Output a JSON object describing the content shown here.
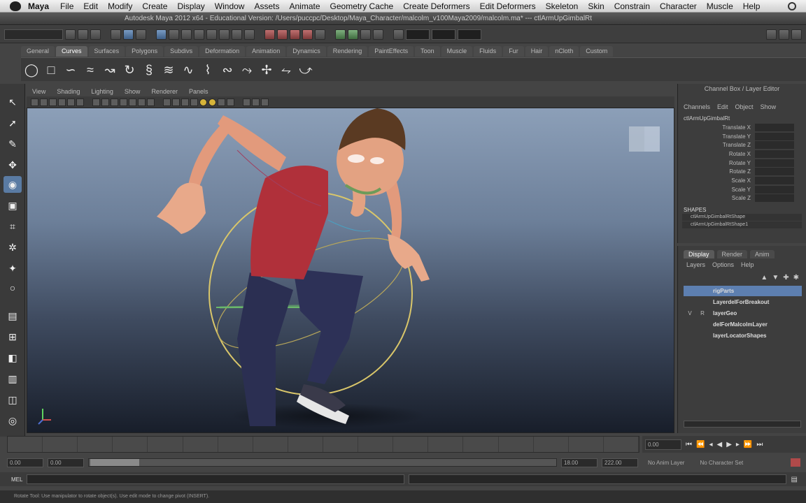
{
  "menubar": {
    "app": "Maya",
    "items": [
      "File",
      "Edit",
      "Modify",
      "Create",
      "Display",
      "Window",
      "Assets",
      "Animate",
      "Geometry Cache",
      "Create Deformers",
      "Edit Deformers",
      "Skeleton",
      "Skin",
      "Constrain",
      "Character",
      "Muscle",
      "Help"
    ]
  },
  "window": {
    "title": "Autodesk Maya 2012 x64 - Educational Version: /Users/puccpc/Desktop/Maya_Character/malcolm_v100Maya2009/malcolm.ma* --- ctlArmUpGimbalRt"
  },
  "shelf": {
    "tabs": [
      "General",
      "Curves",
      "Surfaces",
      "Polygons",
      "Subdivs",
      "Deformation",
      "Animation",
      "Dynamics",
      "Rendering",
      "PaintEffects",
      "Toon",
      "Muscle",
      "Fluids",
      "Fur",
      "Hair",
      "nCloth",
      "Custom"
    ],
    "active_index": 1
  },
  "panel": {
    "menu": [
      "View",
      "Shading",
      "Lighting",
      "Show",
      "Renderer",
      "Panels"
    ]
  },
  "channel_box": {
    "header": "Channel Box / Layer Editor",
    "menu": [
      "Channels",
      "Edit",
      "Object",
      "Show"
    ],
    "object": "ctlArmUpGimbalRt",
    "attributes": [
      "Translate X",
      "Translate Y",
      "Translate Z",
      "Rotate X",
      "Rotate Y",
      "Rotate Z",
      "Scale X",
      "Scale Y",
      "Scale Z"
    ],
    "shapes_label": "SHAPES",
    "shapes": [
      "ctlArmUpGimbalRtShape",
      "ctlArmUpGimbalRtShape1"
    ]
  },
  "layer_editor": {
    "tabs": [
      "Display",
      "Render",
      "Anim"
    ],
    "active_tab": 0,
    "menu": [
      "Layers",
      "Options",
      "Help"
    ],
    "layers": [
      {
        "vis": "",
        "p": "",
        "name": "rigParts",
        "selected": true
      },
      {
        "vis": "",
        "p": "",
        "name": "LayerdelForBreakout",
        "selected": false
      },
      {
        "vis": "V",
        "p": "R",
        "name": "layerGeo",
        "selected": false
      },
      {
        "vis": "",
        "p": "",
        "name": "delForMalcolmLayer",
        "selected": false
      },
      {
        "vis": "",
        "p": "",
        "name": "layerLocatorShapes",
        "selected": false
      }
    ]
  },
  "timeline": {
    "current_time": "0.00",
    "range_start": "0.00",
    "range_start_inner": "0.00",
    "range_end_inner": "18.00",
    "range_end": "222.00",
    "anim_layer": "No Anim Layer",
    "character_set": "No Character Set"
  },
  "cmdline": {
    "label": "MEL"
  },
  "helpline": {
    "text": "Rotate Tool: Use manipulator to rotate object(s). Use edit mode to change pivot (INSERT)."
  },
  "colors": {
    "selection": "#5d7fb0",
    "viewport_top": "#8c9fb8",
    "viewport_bottom": "#181e2a"
  }
}
